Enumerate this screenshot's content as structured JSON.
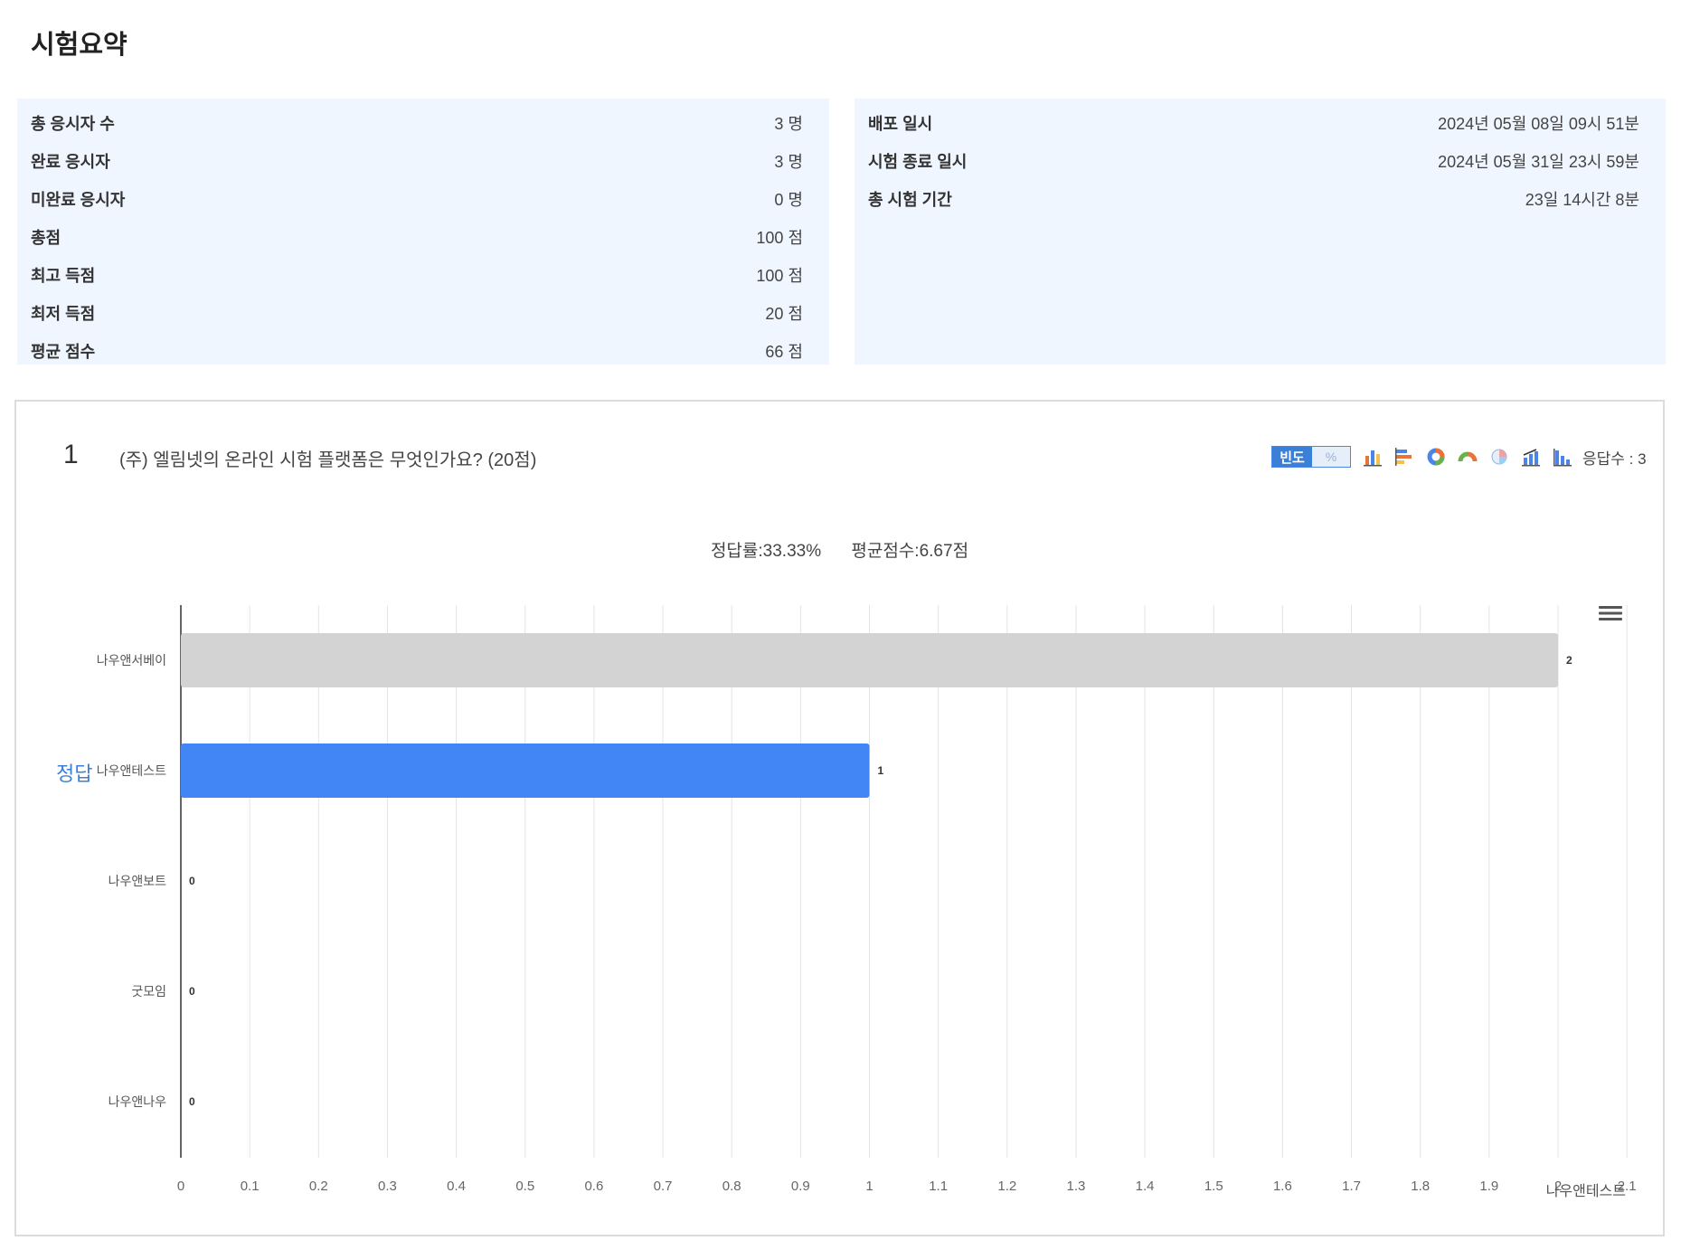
{
  "title": "시험요약",
  "summary_left": [
    {
      "label": "총 응시자 수",
      "value": "3 명"
    },
    {
      "label": "완료 응시자",
      "value": "3 명"
    },
    {
      "label": "미완료 응시자",
      "value": "0 명"
    },
    {
      "label": "총점",
      "value": "100 점"
    },
    {
      "label": "최고 득점",
      "value": "100 점"
    },
    {
      "label": "최저 득점",
      "value": "20 점"
    },
    {
      "label": "평균 점수",
      "value": "66 점"
    }
  ],
  "summary_right": [
    {
      "label": "배포 일시",
      "value": "2024년 05월 08일 09시 51분"
    },
    {
      "label": "시험 종료 일시",
      "value": "2024년 05월 31일 23시 59분"
    },
    {
      "label": "총 시험 기간",
      "value": "23일 14시간 8분"
    }
  ],
  "question": {
    "number": "1",
    "text": "(주) 엘림넷의 온라인 시험 플랫폼은 무엇인가요? (20점)",
    "toggle_on": "빈도",
    "toggle_off": "%",
    "response_count": "응답수 : 3",
    "stats_correct_rate": "정답률:33.33%",
    "stats_avg": "평균점수:6.67점",
    "correct_label": "정답",
    "chart_icons": [
      "bar-chart-icon",
      "horizontal-bar-icon",
      "donut-chart-icon",
      "semicircle-chart-icon",
      "pie-chart-icon",
      "stacked-bar-icon",
      "stacked-horizontal-icon"
    ]
  },
  "chart_data": {
    "type": "bar",
    "orientation": "horizontal",
    "categories": [
      "나우앤서베이",
      "나우앤테스트",
      "나우앤보트",
      "굿모임",
      "나우앤나우"
    ],
    "values": [
      2,
      1,
      0,
      0,
      0
    ],
    "correct_category": "나우앤테스트",
    "xlim": [
      0,
      2.1
    ],
    "xticks": [
      "0",
      "0.1",
      "0.2",
      "0.3",
      "0.4",
      "0.5",
      "0.6",
      "0.7",
      "0.8",
      "0.9",
      "1",
      "1.1",
      "1.2",
      "1.3",
      "1.4",
      "1.5",
      "1.6",
      "1.7",
      "1.8",
      "1.9",
      "2",
      "2.1"
    ],
    "x_axis_note": "나우앤테스트",
    "grid": true,
    "colors": {
      "default": "#d3d3d3",
      "correct": "#4285f4"
    }
  }
}
